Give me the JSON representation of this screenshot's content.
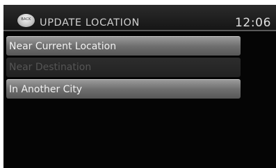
{
  "header": {
    "back_icon_text": "BACK",
    "title": "UPDATE LOCATION",
    "clock": "12:06"
  },
  "menu": {
    "items": [
      {
        "label": "Near Current Location",
        "enabled": true
      },
      {
        "label": "Near Destination",
        "enabled": false
      },
      {
        "label": "In Another City",
        "enabled": true
      }
    ]
  },
  "colors": {
    "screen_background": "#050505",
    "header_background": "#1e1e1e",
    "enabled_item": "#6f6f6f",
    "disabled_item": "#222222",
    "disabled_text": "#555555"
  }
}
